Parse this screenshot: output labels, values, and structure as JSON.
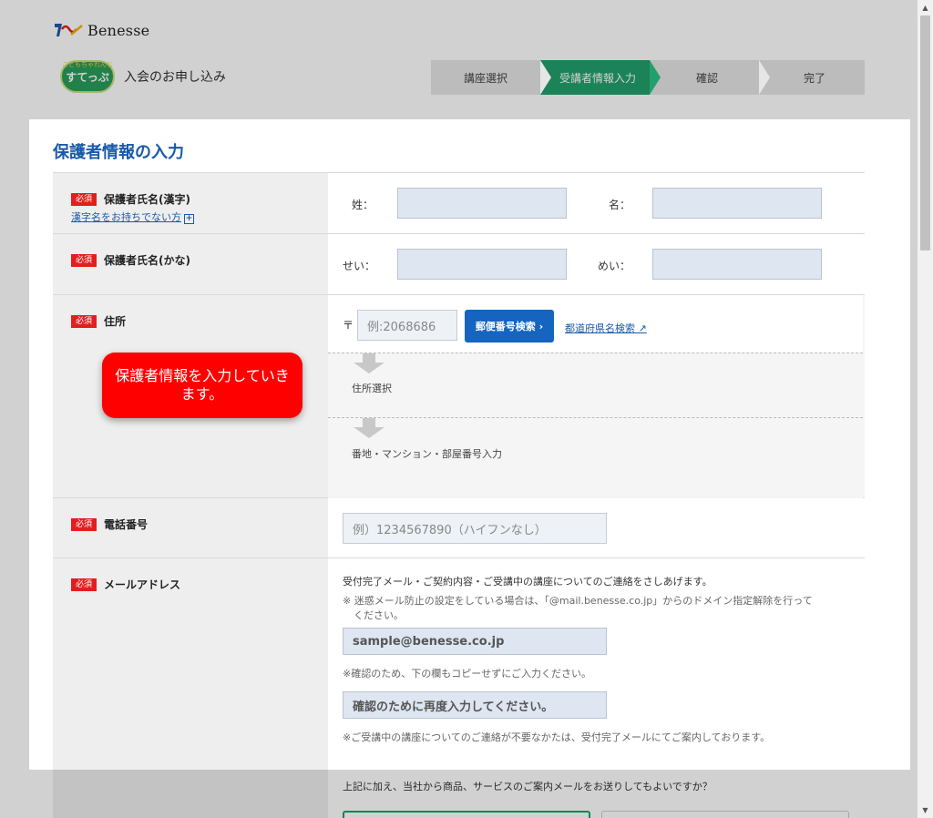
{
  "header": {
    "brand_name": "Benesse",
    "badge_small": "こどもちゃれんじ",
    "badge_main": "すてっぷ",
    "app_title": "入会のお申し込み"
  },
  "steps": [
    {
      "label": "講座選択",
      "active": false
    },
    {
      "label": "受講者情報入力",
      "active": true
    },
    {
      "label": "確認",
      "active": false
    },
    {
      "label": "完了",
      "active": false
    }
  ],
  "card": {
    "title": "保護者情報の入力"
  },
  "required_badge": "必須",
  "name_kanji": {
    "label": "保護者氏名(漢字)",
    "sub_link": "漢字名をお持ちでない方",
    "plus": "+",
    "last_label": "姓：",
    "first_label": "名：",
    "last_value": "",
    "first_value": ""
  },
  "name_kana": {
    "label": "保護者氏名(かな)",
    "last_label": "せい：",
    "first_label": "めい：",
    "last_value": "",
    "first_value": ""
  },
  "address": {
    "label": "住所",
    "postal_mark": "〒",
    "postal_placeholder": "例:2068686",
    "zip_button": "郵便番号検索 ›",
    "pref_link": "都道府県名検索",
    "step1": "住所選択",
    "step2": "番地・マンション・部屋番号入力"
  },
  "tooltip": {
    "text": "保護者情報を入力していきます。"
  },
  "phone": {
    "label": "電話番号",
    "placeholder": "例）1234567890（ハイフンなし）"
  },
  "email": {
    "label": "メールアドレス",
    "note1": "受付完了メール・ご契約内容・ご受講中の講座についてのご連絡をさしあげます。",
    "note2": "※ 迷惑メール防止の設定をしている場合は、「@mail.benesse.co.jp」からのドメイン指定解除を行って",
    "note2b": "ください。",
    "placeholder": "sample@benesse.co.jp",
    "confirm_note": "※確認のため、下の欄もコピーせずにご入力ください。",
    "confirm_placeholder": "確認のために再度入力してください。",
    "footer_note": "※ご受講中の講座についてのご連絡が不要なかたは、受付完了メールにてご案内しております。"
  },
  "newsletter": {
    "question": "上記に加え、当社から商品、サービスのご案内メールをお送りしてもよいですか？"
  },
  "colors": {
    "accent_green": "#22a06b",
    "primary_blue": "#1565c0",
    "required_red": "#e21f1f",
    "tooltip_red": "#ff0000"
  }
}
